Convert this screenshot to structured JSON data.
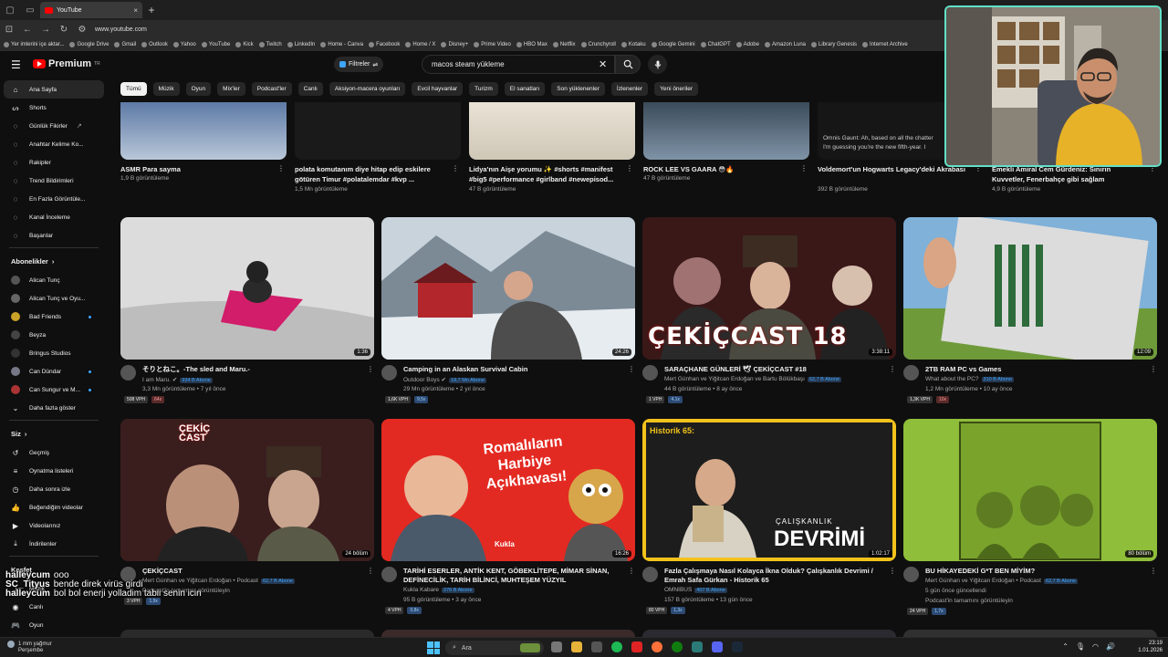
{
  "browser": {
    "tab_title": "YouTube",
    "url": "www.youtube.com",
    "bookmarks": [
      "Yer imlerini içe aktar...",
      "Google Drive",
      "Gmail",
      "Outlook",
      "Yahoo",
      "YouTube",
      "Kick",
      "Twitch",
      "LinkedIn",
      "Home - Canva",
      "Facebook",
      "Home / X",
      "Disney+",
      "Prime Video",
      "HBO Max",
      "Netflix",
      "Crunchyroll",
      "Kotaku",
      "Google Gemini",
      "ChatGPT",
      "Adobe",
      "Amazon Luna",
      "Library Genesis",
      "Internet Archive"
    ]
  },
  "masthead": {
    "logo_text": "Premium",
    "logo_sup": "TR",
    "filters_label": "Filtreler",
    "search_value": "macos steam yükleme"
  },
  "chips": [
    "Tümü",
    "Müzik",
    "Oyun",
    "Mix'ler",
    "Podcast'ler",
    "Canlı",
    "Aksiyon-macera oyunları",
    "Evcil hayvanlar",
    "Turizm",
    "El sanatları",
    "Son yüklenenler",
    "İzlenenler",
    "Yeni öneriler"
  ],
  "sidebar": {
    "main": [
      {
        "label": "Ana Sayfa",
        "icon": "home-icon"
      },
      {
        "label": "Shorts",
        "icon": "shorts-icon"
      }
    ],
    "tools": [
      "Günlük Fikirler",
      "Anahtar Kelime Ko...",
      "Rakipler",
      "Trend Bildirimleri",
      "En Fazla Görüntüle...",
      "Kanal İnceleme",
      "Başarılar"
    ],
    "subs_header": "Abonelikler",
    "subs": [
      {
        "label": "Alican Tunç",
        "dot": false
      },
      {
        "label": "Alican Tunç ve Oyu...",
        "dot": false
      },
      {
        "label": "Bad Friends",
        "dot": true
      },
      {
        "label": "Beyza",
        "dot": false
      },
      {
        "label": "Bringus Studios",
        "dot": false
      },
      {
        "label": "Can Dündar",
        "dot": true
      },
      {
        "label": "Can Sungur ve M...",
        "dot": true
      }
    ],
    "more_label": "Daha fazla göster",
    "you_header": "Siz",
    "you": [
      "Geçmiş",
      "Oynatma listeleri",
      "Daha sonra izle",
      "Beğendiğim videolar",
      "Videolarınız",
      "İndirilenler"
    ],
    "explore_header": "Keşfet",
    "explore": [
      "Müzik",
      "Canlı",
      "Oyun"
    ]
  },
  "row1": [
    {
      "title": "ASMR Para sayma",
      "meta": "1,9 B görüntüleme"
    },
    {
      "title": "polata komutanım diye hitap edip eskilere götüren Timur #polatalemdar #kvp ...",
      "meta": "1,5 Mn görüntüleme"
    },
    {
      "title": "Lidya'nın Aişe yorumu ✨ #shorts #manifest #big5 #performance #girlband #newepisod...",
      "meta": "47 B görüntüleme"
    },
    {
      "title": "ROCK LEE VS GAARA 😳🔥",
      "meta": "47 B görüntüleme"
    },
    {
      "title": "Voldemort'un Hogwarts Legacy'deki Akrabası",
      "meta": "392 B görüntüleme",
      "caption1": "Omnis Gaunt:  Ah, based on all the chatter",
      "caption2": "I'm guessing you're the new fifth-year. I"
    },
    {
      "title": "Emekli Amiral Cem Gürdeniz: Sınırın Kuvvetler, Fenerbahçe gibi sağlam durabileyedi. ...",
      "meta": "4,9 B görüntüleme"
    }
  ],
  "row2": [
    {
      "title": "そりとねこ。-The sled and Maru.-",
      "channel": "I am Maru.",
      "verified": true,
      "subs": "934 B Abone",
      "views": "3,3 Mn görüntüleme • 7 yıl önce",
      "vph": "508 VPH",
      "mult": "64x",
      "mult_red": true,
      "duration": "1:36"
    },
    {
      "title": "Camping in an Alaskan Survival Cabin",
      "channel": "Outdoor Boys",
      "verified": true,
      "subs": "18,7 Mn Abone",
      "views": "29 Mn görüntüleme • 2 yıl önce",
      "vph": "1,6K VPH",
      "mult": "9,5x",
      "mult_red": false,
      "duration": "24:26"
    },
    {
      "title": "SARAÇHANE GÜNLERİ 🕊 ÇEKİÇCAST #18",
      "channel": "Mert Günhan ve Yiğitcan Erdoğan ve Bartu Bölükbaşı",
      "verified": false,
      "subs": "62,7 B Abone",
      "views": "44 B görüntüleme • 8 ay önce",
      "vph": "1 VPH",
      "mult": "4,1x",
      "mult_red": false,
      "duration": "3:38:11",
      "overlay": "ÇEKİÇCAST 18"
    },
    {
      "title": "2TB RAM PC vs Games",
      "channel": "What about the PC?",
      "verified": false,
      "subs": "310 B Abone",
      "views": "1,2 Mn görüntüleme • 10 ay önce",
      "vph": "1,3K VPH",
      "mult": "10x",
      "mult_red": true,
      "duration": "12:09"
    }
  ],
  "row3": [
    {
      "title": "ÇEKİÇCAST",
      "channel": "Mert Günhan ve Yiğitcan Erdoğan • Podcast",
      "subs": "62,7 B Abone",
      "views": "Podcast'in tamamını görüntüleyin",
      "vph": "3 VPH",
      "mult": "1,9x",
      "duration": "24 bölüm",
      "overlay": "ÇEKİÇ CAST"
    },
    {
      "title": "TARİHİ ESERLER, ANTİK KENT, GÖBEKLİTEPE, MİMAR SİNAN, DEFİNECİLİK, TARİH BİLİNCİ, MUHTEŞEM YÜZYIL",
      "channel": "Kukla Kabare",
      "subs": "276 B Abone",
      "views": "95 B görüntüleme • 3 ay önce",
      "vph": "4 VPH",
      "mult": "0,8x",
      "duration": "16:26",
      "overlay": "Romalıların Harbiye Açıkhavası!",
      "overlay_small": "Kukla"
    },
    {
      "title": "Fazla Çalışmaya Nasıl Kolayca İkna Olduk? Çalışkanlık Devrimi / Emrah Safa Gürkan - Historik 65",
      "channel": "OMNIBUS",
      "subs": "407 B Abone",
      "views": "157 B görüntüleme • 13 gün önce",
      "vph": "80 VPH",
      "mult": "1,3x",
      "duration": "1:02:17",
      "overlay": "Historik 65:",
      "overlay_b": "ÇALIŞKANLIK",
      "overlay_c": "DEVRİMİ"
    },
    {
      "title": "BU HİKAYEDEKİ G*T BEN MİYİM?",
      "channel": "Mert Günhan ve Yiğitcan Erdoğan • Podcast",
      "subs": "62,7 B Abone",
      "views": "5 gün önce güncellendi",
      "views2": "Podcast'in tamamını görüntüleyin",
      "vph": "24 VPH",
      "mult": "1,7x",
      "duration": "80 bölüm"
    }
  ],
  "chat": [
    {
      "user": "halleycum",
      "msg": "ooo"
    },
    {
      "user": "SC_Tityus",
      "msg": "bende direk virüs girdi"
    },
    {
      "user": "halleycum",
      "msg": "bol bol enerji yolladim tabii senin icin"
    }
  ],
  "taskbar": {
    "weather_line1": "1 mm yağmur",
    "weather_line2": "Perşembe",
    "search_label": "Ara",
    "time": "23:19",
    "date": "1.01.2026"
  },
  "colors": {
    "accent": "#3ea6ff",
    "youtube_red": "#ff0000",
    "webcam_border": "#62e0c8"
  }
}
